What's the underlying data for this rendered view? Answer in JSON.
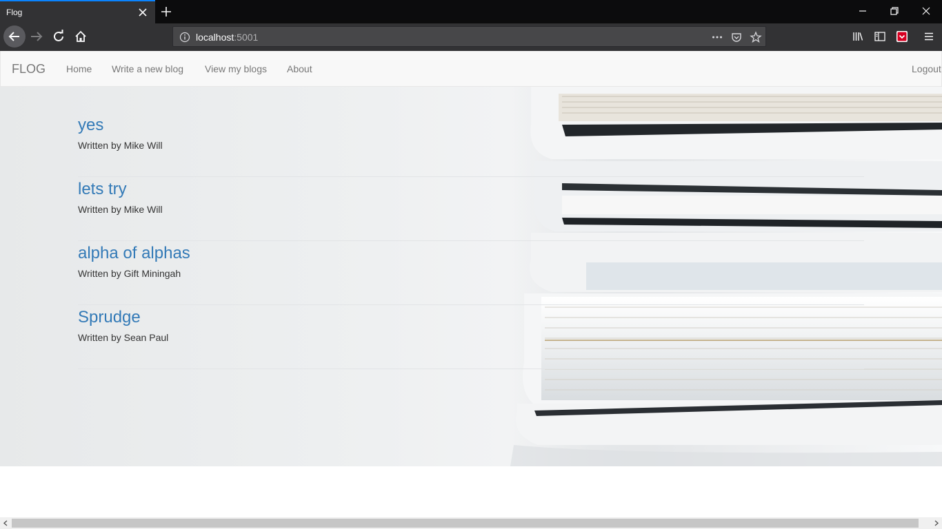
{
  "browser": {
    "tab_title": "Flog",
    "url_host": "localhost",
    "url_port": ":5001"
  },
  "site": {
    "brand": "FLOG",
    "nav_links": [
      "Home",
      "Write a new blog",
      "View my blogs",
      "About"
    ],
    "logout": "Logout"
  },
  "posts": [
    {
      "title": "yes",
      "author": "Written by Mike Will"
    },
    {
      "title": "lets try",
      "author": "Written by Mike Will"
    },
    {
      "title": "alpha of alphas",
      "author": "Written by Gift Miningah"
    },
    {
      "title": "Sprudge",
      "author": "Written by Sean Paul"
    }
  ],
  "colors": {
    "link": "#337ab7",
    "nav_text": "#777777",
    "chrome_dark": "#0c0c0d",
    "chrome_toolbar": "#323234",
    "tab_accent": "#0a84ff"
  }
}
